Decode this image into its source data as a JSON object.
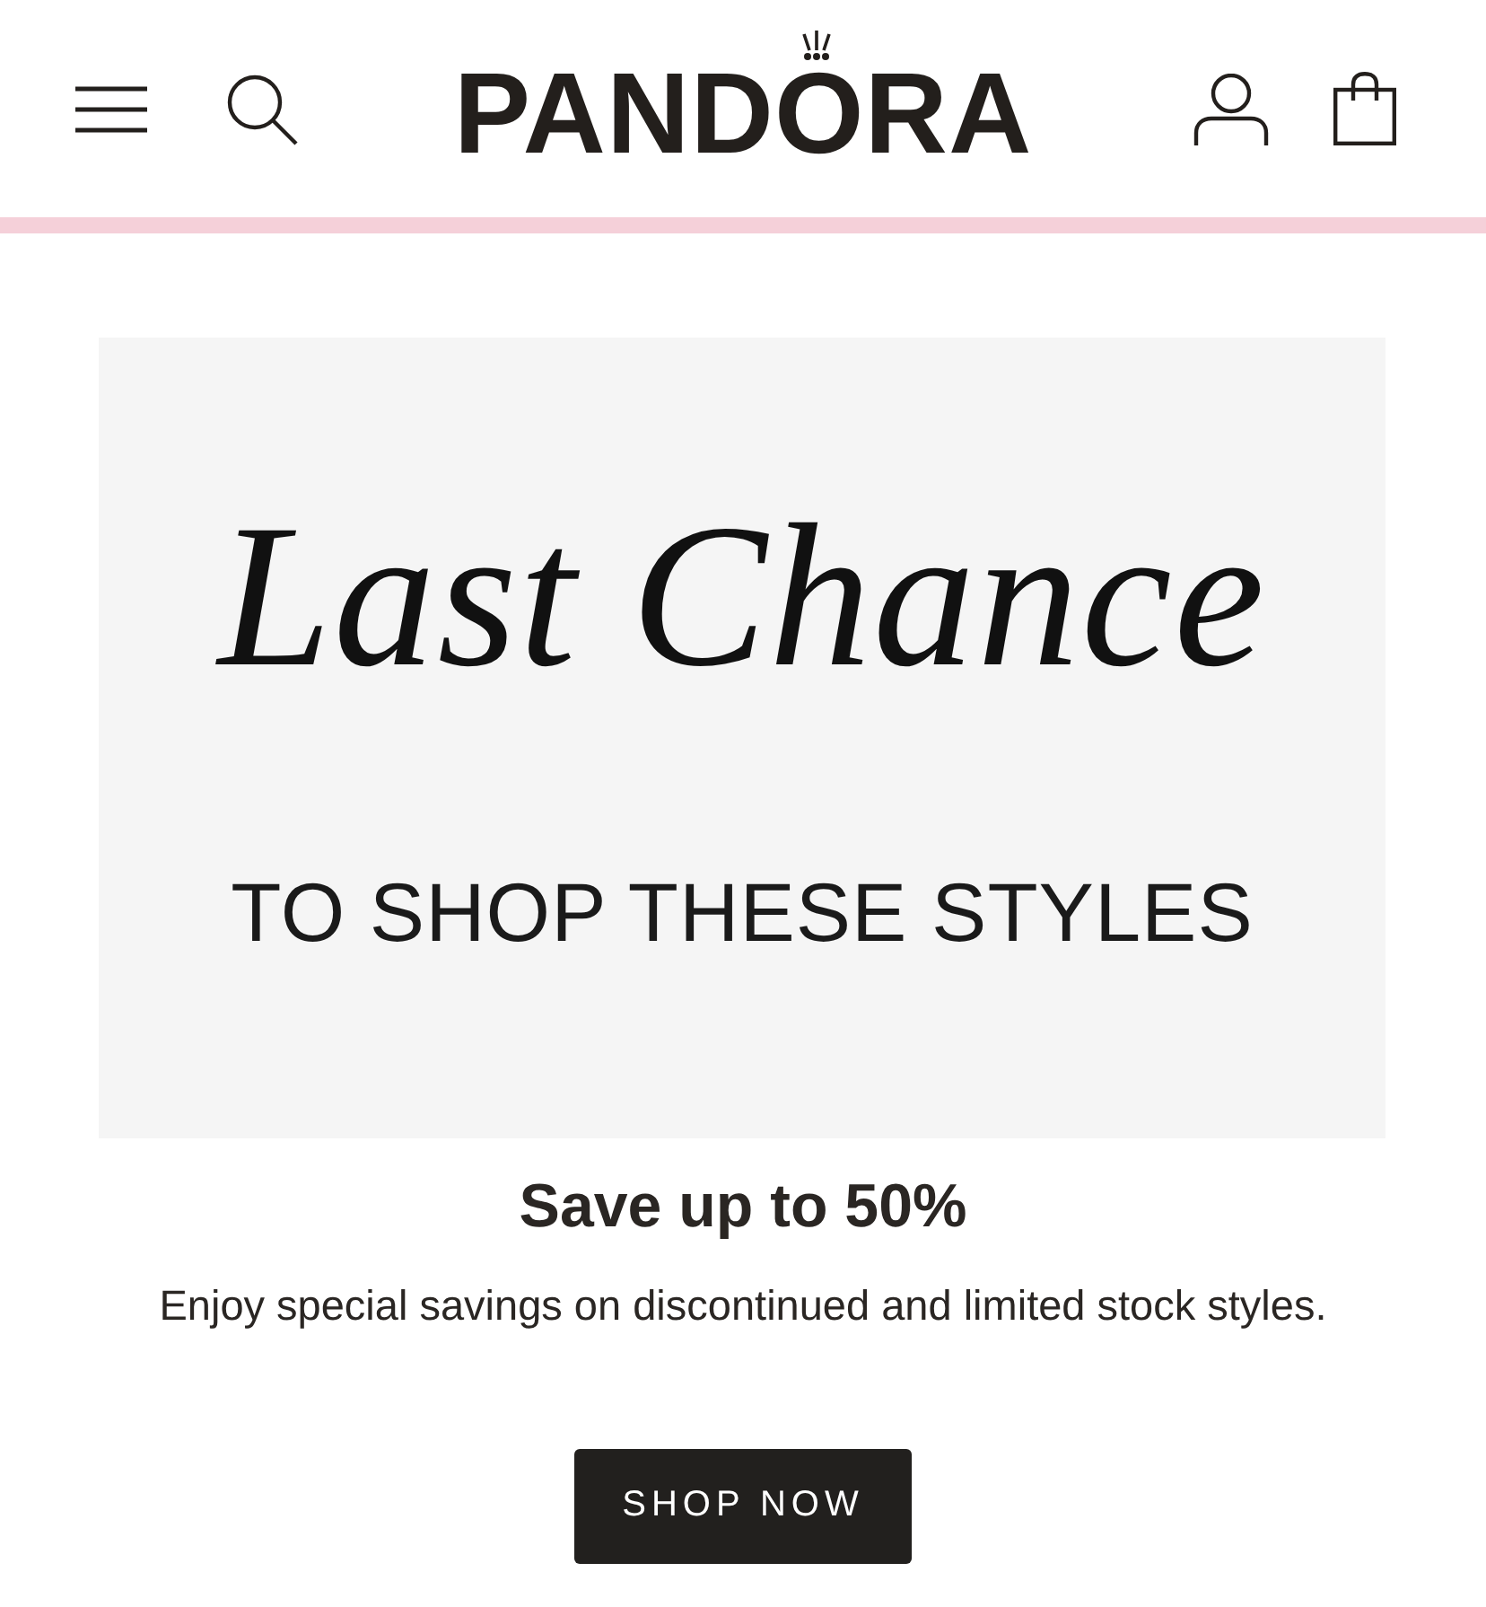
{
  "header": {
    "logo": "PANDORA"
  },
  "banner": {
    "headline": "Last Chance",
    "subheadline": "TO SHOP THESE STYLES"
  },
  "promo": {
    "title": "Save up to 50%",
    "description": "Enjoy special savings on discontinued and limited stock styles.",
    "button": "SHOP NOW"
  }
}
